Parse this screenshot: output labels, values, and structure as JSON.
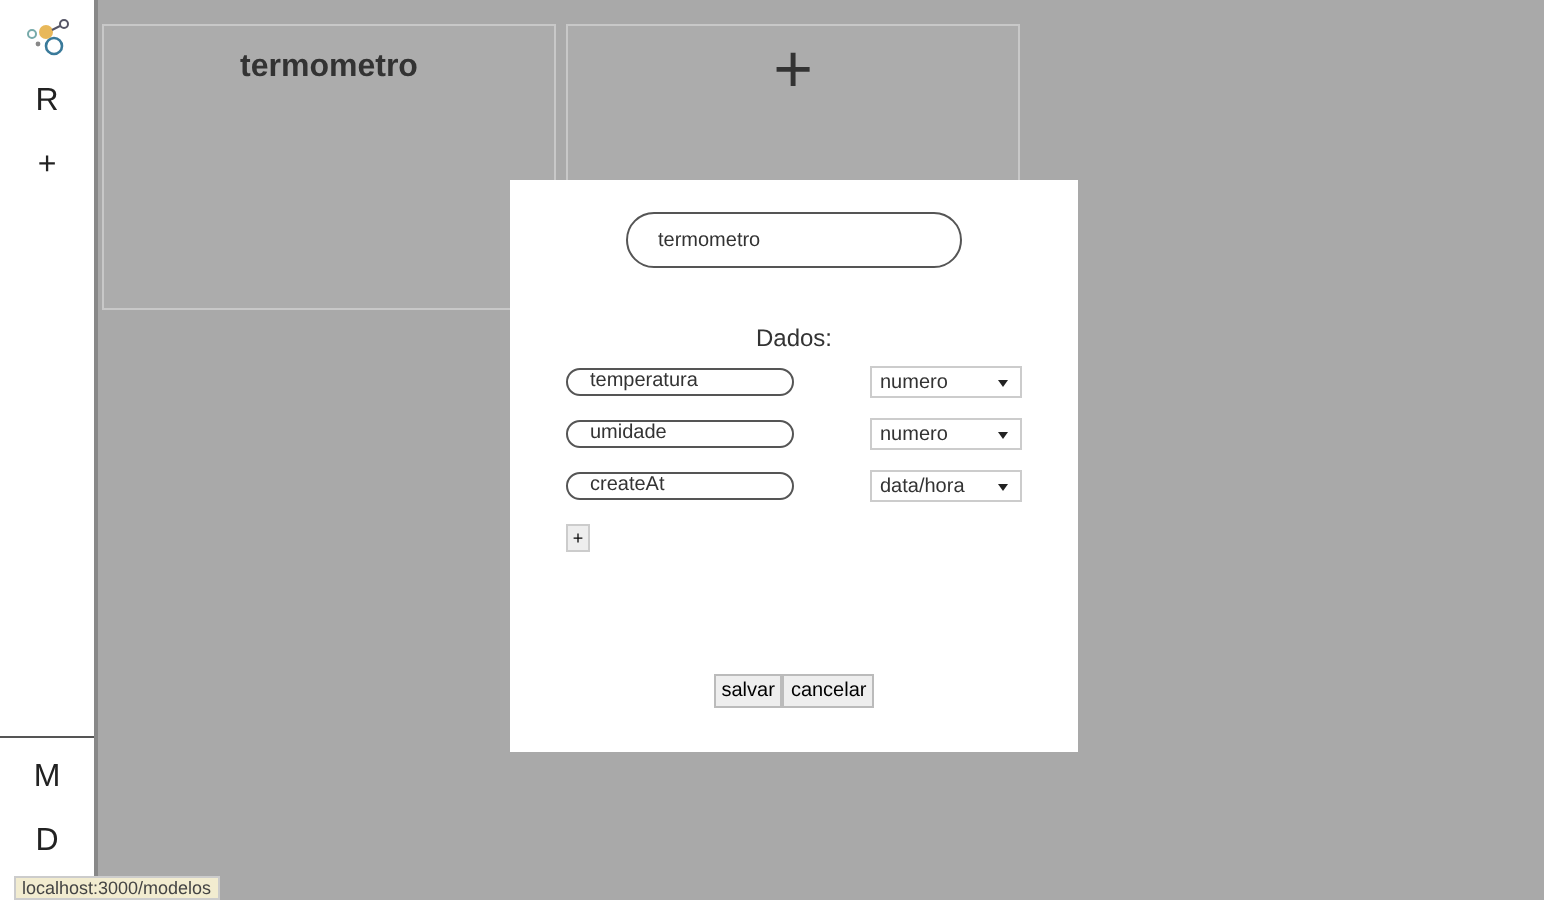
{
  "sidebar": {
    "top_items": [
      {
        "kind": "logo"
      },
      {
        "kind": "text",
        "label": "R"
      },
      {
        "kind": "text",
        "label": "+"
      }
    ],
    "bottom_items": [
      {
        "kind": "text",
        "label": "M"
      },
      {
        "kind": "text",
        "label": "D"
      }
    ]
  },
  "cards": [
    {
      "kind": "model",
      "title": "termometro"
    },
    {
      "kind": "add",
      "label": "+"
    }
  ],
  "modal": {
    "name_value": "termometro",
    "section_label": "Dados:",
    "fields": [
      {
        "name": "temperatura",
        "type": "numero"
      },
      {
        "name": "umidade",
        "type": "numero"
      },
      {
        "name": "createAt",
        "type": "data/hora"
      }
    ],
    "add_label": "+",
    "buttons": [
      "salvar",
      "cancelar"
    ]
  },
  "status_bar": {
    "url": "localhost:3000/modelos"
  }
}
